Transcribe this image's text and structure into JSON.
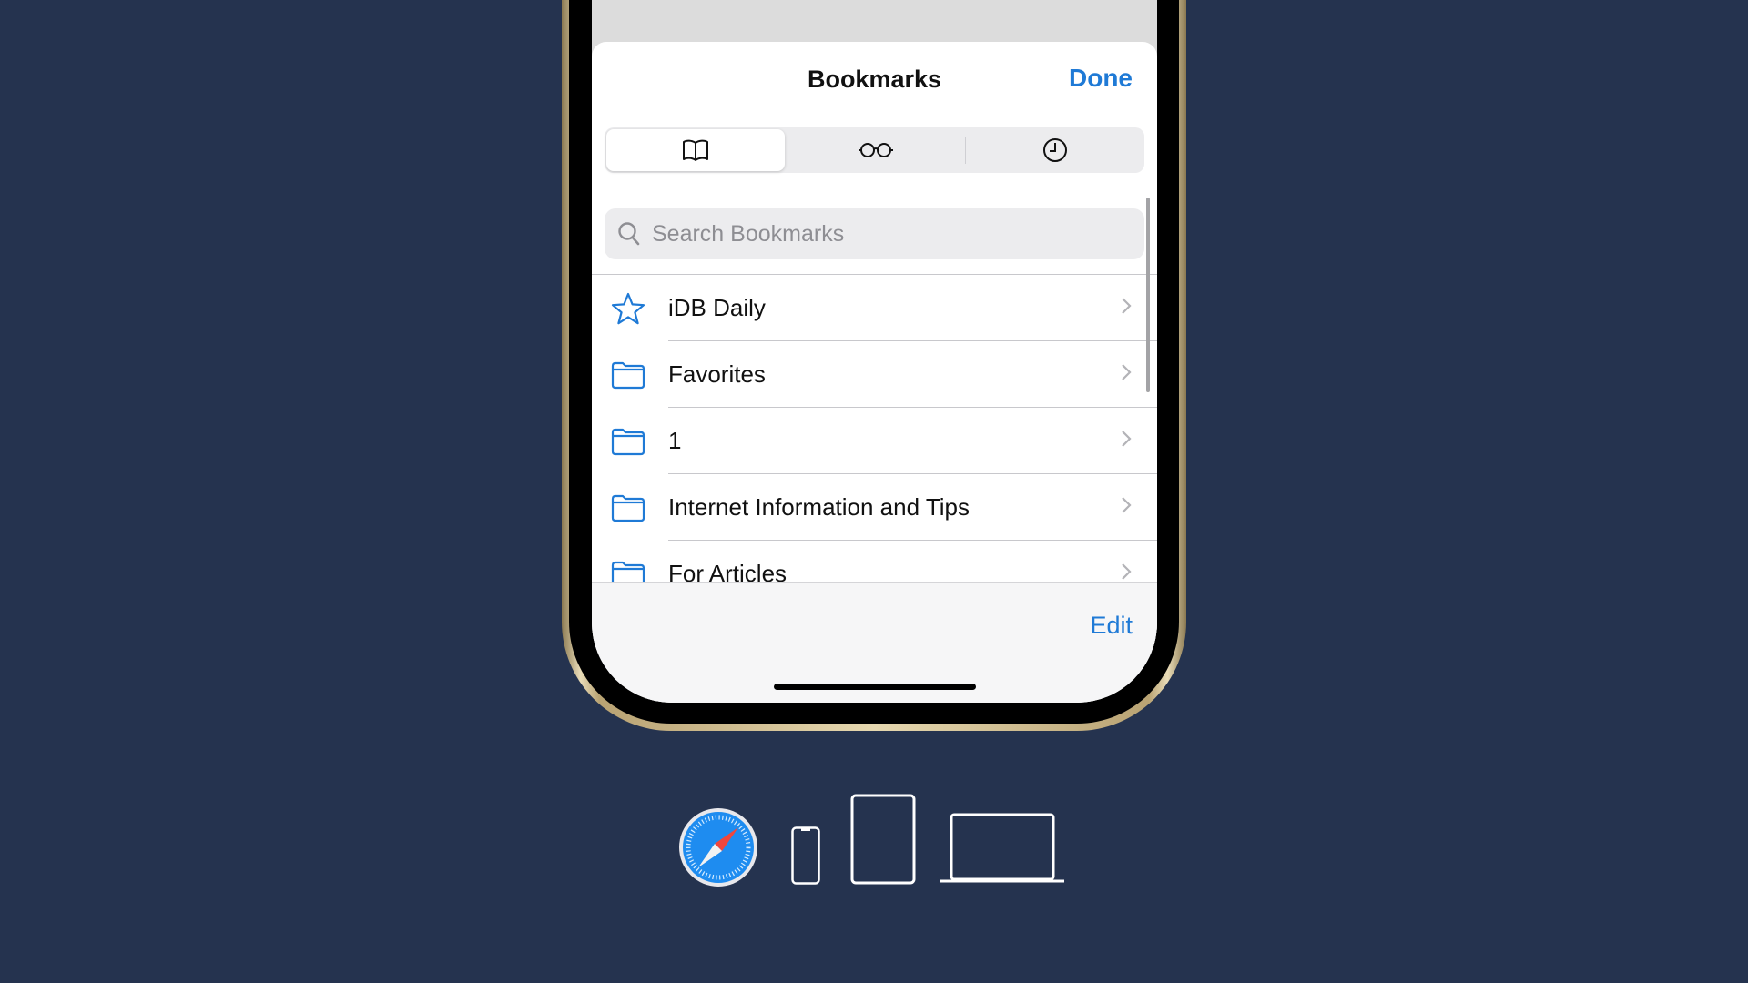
{
  "sheet": {
    "title": "Bookmarks",
    "done_label": "Done",
    "edit_label": "Edit"
  },
  "segments": [
    {
      "icon": "book-icon",
      "active": true
    },
    {
      "icon": "reading-list-glasses-icon",
      "active": false
    },
    {
      "icon": "history-clock-icon",
      "active": false
    }
  ],
  "search": {
    "placeholder": "Search Bookmarks",
    "value": ""
  },
  "bookmarks": [
    {
      "label": "iDB Daily",
      "icon": "star-icon"
    },
    {
      "label": "Favorites",
      "icon": "folder-icon"
    },
    {
      "label": "1",
      "icon": "folder-icon"
    },
    {
      "label": "Internet Information and Tips",
      "icon": "folder-icon"
    },
    {
      "label": "For Articles",
      "icon": "folder-icon"
    }
  ],
  "dock_icons": [
    "safari-icon",
    "iphone-icon",
    "ipad-icon",
    "macbook-icon"
  ],
  "colors": {
    "accent": "#1f7ad6",
    "background": "#25334f",
    "frame_gold": "#e6d8b0"
  }
}
